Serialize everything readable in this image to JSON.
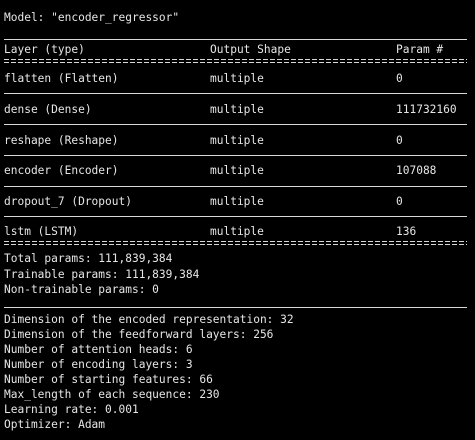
{
  "model_title": "Model: \"encoder_regressor\"",
  "table": {
    "headers": {
      "layer": "Layer (type)",
      "output": "Output Shape",
      "params": "Param #"
    },
    "rows": [
      {
        "layer": "flatten (Flatten)",
        "output": "multiple",
        "params": "0"
      },
      {
        "layer": "dense (Dense)",
        "output": "multiple",
        "params": "111732160"
      },
      {
        "layer": "reshape (Reshape)",
        "output": "multiple",
        "params": "0"
      },
      {
        "layer": "encoder (Encoder)",
        "output": "multiple",
        "params": "107088"
      },
      {
        "layer": "dropout_7 (Dropout)",
        "output": "multiple",
        "params": "0"
      },
      {
        "layer": "lstm (LSTM)",
        "output": "multiple",
        "params": "136"
      }
    ]
  },
  "summary": {
    "total": "Total params: 111,839,384",
    "trainable": "Trainable params: 111,839,384",
    "non_trainable": "Non-trainable params: 0"
  },
  "hyperparams": [
    "Dimension of the encoded representation: 32",
    "Dimension of the feedforward layers: 256",
    "Number of attention heads: 6",
    "Number of encoding layers: 3",
    "Number of starting features: 66",
    "Max_length of each sequence: 230",
    "Learning rate: 0.001",
    "Optimizer: Adam"
  ]
}
